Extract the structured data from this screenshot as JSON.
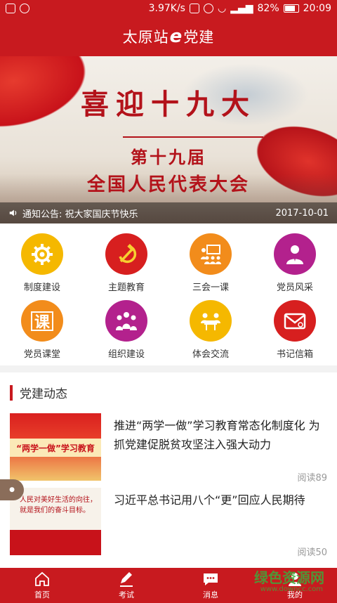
{
  "status_bar": {
    "speed": "3.97K/s",
    "battery": "82%",
    "time": "20:09"
  },
  "header": {
    "title_prefix": "太原站",
    "title_e": "e",
    "title_suffix": "党建"
  },
  "banner": {
    "title_main": "喜迎十九大",
    "title_sub1": "第十九届",
    "title_sub2": "全国人民代表大会",
    "notice_text": "通知公告: 祝大家国庆节快乐",
    "notice_date": "2017-10-01"
  },
  "grid": [
    {
      "label": "制度建设",
      "icon": "gear-icon",
      "color": "#f5b800"
    },
    {
      "label": "主题教育",
      "icon": "hammer-sickle-icon",
      "color": "#d71f1f"
    },
    {
      "label": "三会一课",
      "icon": "meeting-icon",
      "color": "#f28c1b"
    },
    {
      "label": "党员风采",
      "icon": "person-icon",
      "color": "#b3218d"
    },
    {
      "label": "党员课堂",
      "icon": "lesson-icon",
      "color": "#f28c1b"
    },
    {
      "label": "组织建设",
      "icon": "group-icon",
      "color": "#b3218d"
    },
    {
      "label": "体会交流",
      "icon": "discussion-icon",
      "color": "#f5b800"
    },
    {
      "label": "书记信箱",
      "icon": "mail-icon",
      "color": "#d71f1f"
    }
  ],
  "section": {
    "title": "党建动态"
  },
  "news": [
    {
      "title": "推进“两学一做”学习教育常态化制度化 为抓党建促脱贫攻坚注入强大动力",
      "reads": "阅读89",
      "thumb_text": "“两学一做”学习教育"
    },
    {
      "title": "习近平总书记用八个“更”回应人民期待",
      "reads": "阅读50",
      "thumb_text": "人民对美好生活的向往，就是我们的奋斗目标。"
    }
  ],
  "bottom_nav": [
    {
      "label": "首页",
      "icon": "home-icon"
    },
    {
      "label": "考试",
      "icon": "pencil-icon"
    },
    {
      "label": "消息",
      "icon": "message-icon"
    },
    {
      "label": "我的",
      "icon": "user-icon"
    }
  ],
  "watermark": {
    "text": "绿色资源网",
    "url": "www.downcc.com"
  },
  "colors": {
    "brand": "#c81a1f"
  }
}
